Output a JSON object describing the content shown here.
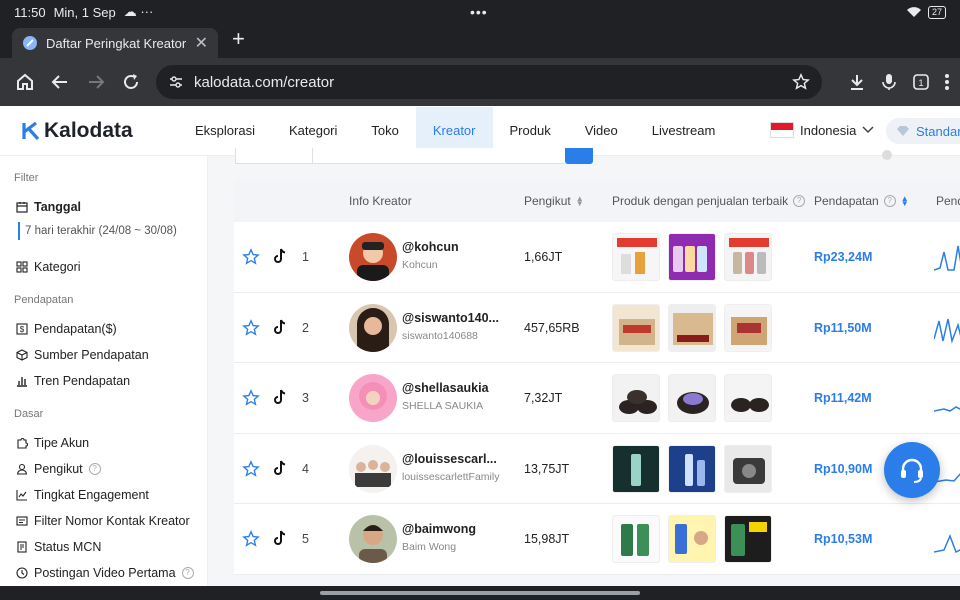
{
  "status": {
    "time": "11:50",
    "date": "Min, 1 Sep",
    "cloud": "☁ ···",
    "center": "•••",
    "battery": "27"
  },
  "tab": {
    "title": "Daftar Peringkat Kreator Tik",
    "close": "✕",
    "new": "+"
  },
  "omnibox": {
    "url": "kalodata.com/creator"
  },
  "nav": {
    "logo": "Kalodata",
    "items": [
      "Eksplorasi",
      "Kategori",
      "Toko",
      "Kreator",
      "Produk",
      "Video",
      "Livestream"
    ],
    "language": "Indonesia",
    "plan": "Standar"
  },
  "sidebar": {
    "filter_title": "Filter",
    "tanggal": "Tanggal",
    "date_range": "7 hari terakhir (24/08 ~ 30/08)",
    "kategori": "Kategori",
    "pendapatan_title": "Pendapatan",
    "pendapatan_items": [
      "Pendapatan($)",
      "Sumber Pendapatan",
      "Tren Pendapatan"
    ],
    "dasar_title": "Dasar",
    "dasar_items": [
      "Tipe Akun",
      "Pengikut",
      "Tingkat Engagement",
      "Filter Nomor Kontak Kreator",
      "Status MCN",
      "Postingan Video Pertama"
    ]
  },
  "table": {
    "headers": {
      "info": "Info Kreator",
      "followers": "Pengikut",
      "products": "Produk dengan penjualan terbaik",
      "revenue": "Pendapatan",
      "trend": "Pend"
    },
    "rows": [
      {
        "rank": "1",
        "handle": "@kohcun",
        "name": "Kohcun",
        "followers": "1,66JT",
        "revenue": "Rp23,24M"
      },
      {
        "rank": "2",
        "handle": "@siswanto140...",
        "name": "siswanto140688",
        "followers": "457,65RB",
        "revenue": "Rp11,50M"
      },
      {
        "rank": "3",
        "handle": "@shellasaukia",
        "name": "SHELLA SAUKIA",
        "followers": "7,32JT",
        "revenue": "Rp11,42M"
      },
      {
        "rank": "4",
        "handle": "@louissescarl...",
        "name": "louissescarlettFamily",
        "followers": "13,75JT",
        "revenue": "Rp10,90M"
      },
      {
        "rank": "5",
        "handle": "@baimwong",
        "name": "Baim Wong",
        "followers": "15,98JT",
        "revenue": "Rp10,53M"
      }
    ]
  },
  "colors": {
    "accent": "#2b7de9",
    "chrome_dark": "#202124",
    "chrome_bar": "#35363a"
  }
}
